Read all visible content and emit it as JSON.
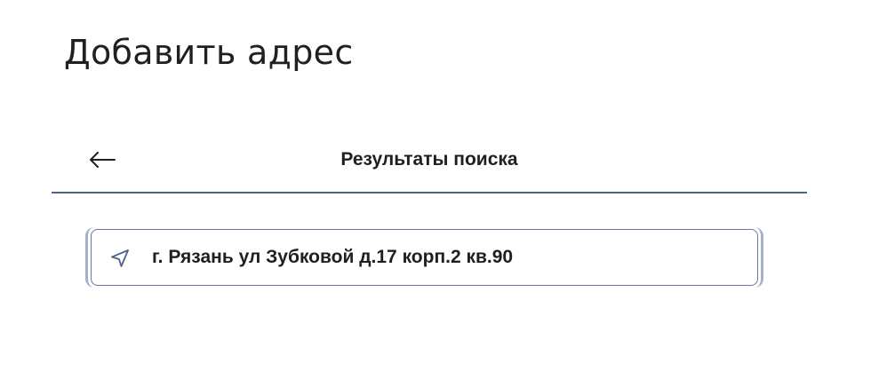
{
  "page": {
    "title": "Добавить адрес"
  },
  "results_header": {
    "title": "Результаты поиска",
    "back_icon": "arrow-left-icon"
  },
  "results": [
    {
      "icon": "navigation-arrow-icon",
      "text": "г. Рязань ул Зубковой д.17 корп.2 кв.90"
    }
  ],
  "colors": {
    "divider": "#4f6188",
    "item_border": "#6b7799",
    "item_outer_border": "#a7b0c8",
    "icon": "#4f6188",
    "text": "#1f1f1f"
  }
}
